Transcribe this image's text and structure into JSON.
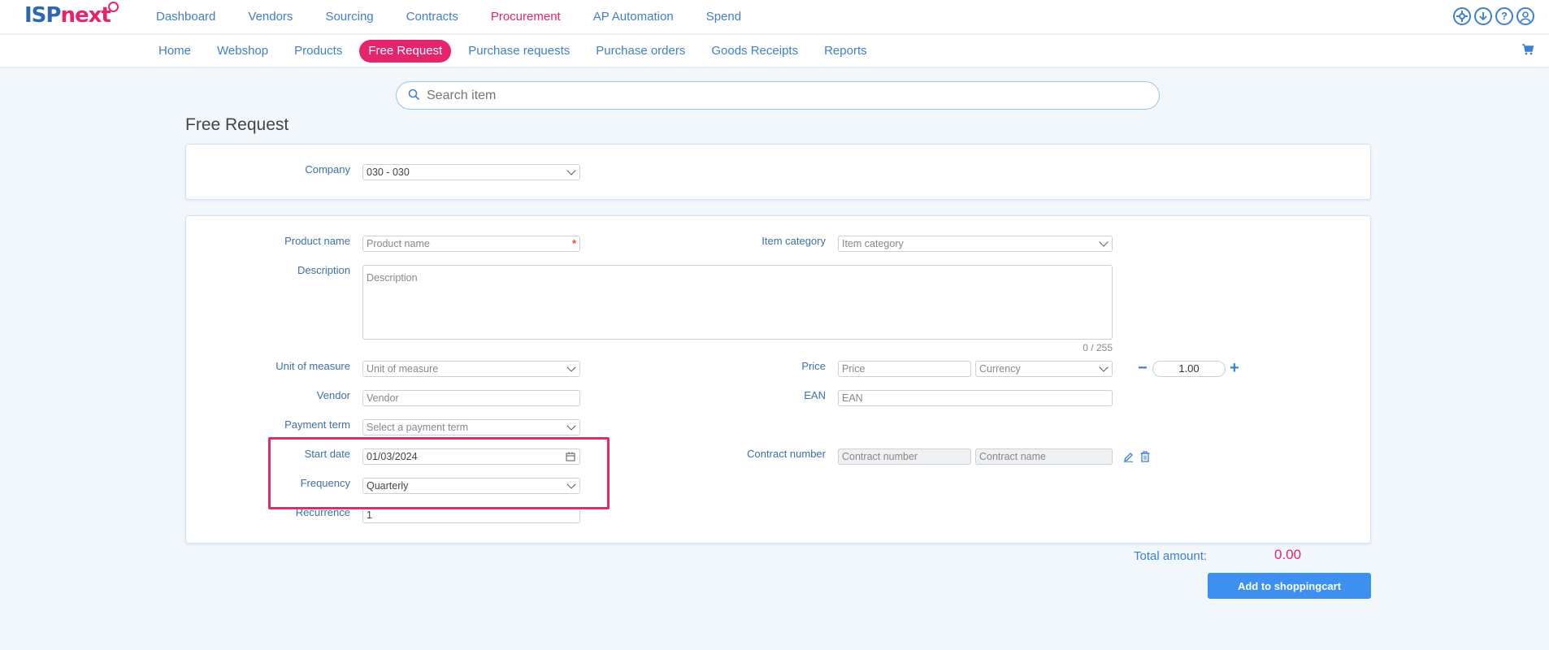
{
  "brand": {
    "logo_left": "ISP",
    "logo_right": "next"
  },
  "topnav": [
    {
      "label": "Dashboard"
    },
    {
      "label": "Vendors"
    },
    {
      "label": "Sourcing"
    },
    {
      "label": "Contracts"
    },
    {
      "label": "Procurement",
      "active": true
    },
    {
      "label": "AP Automation"
    },
    {
      "label": "Spend"
    }
  ],
  "top_icons": [
    "settings-icon",
    "download-icon",
    "help-icon",
    "user-icon"
  ],
  "subnav": [
    {
      "label": "Home"
    },
    {
      "label": "Webshop"
    },
    {
      "label": "Products"
    },
    {
      "label": "Free Request",
      "active": true
    },
    {
      "label": "Purchase requests"
    },
    {
      "label": "Purchase orders"
    },
    {
      "label": "Goods Receipts"
    },
    {
      "label": "Reports"
    }
  ],
  "search": {
    "placeholder": "Search item"
  },
  "page_title": "Free Request",
  "company": {
    "label": "Company",
    "value": "030 - 030"
  },
  "form": {
    "product_name": {
      "label": "Product name",
      "placeholder": "Product name"
    },
    "item_category": {
      "label": "Item category",
      "placeholder": "Item category"
    },
    "description": {
      "label": "Description",
      "placeholder": "Description",
      "counter": "0 / 255"
    },
    "unit_of_measure": {
      "label": "Unit of measure",
      "placeholder": "Unit of measure"
    },
    "price": {
      "label": "Price",
      "placeholder": "Price",
      "currency_placeholder": "Currency",
      "quantity": "1.00",
      "minus": "−",
      "plus": "+"
    },
    "vendor": {
      "label": "Vendor",
      "placeholder": "Vendor"
    },
    "ean": {
      "label": "EAN",
      "placeholder": "EAN"
    },
    "payment_term": {
      "label": "Payment term",
      "placeholder": "Select a payment term"
    },
    "start_date": {
      "label": "Start date",
      "value": "01/03/2024"
    },
    "contract": {
      "label": "Contract number",
      "number_placeholder": "Contract number",
      "name_placeholder": "Contract name"
    },
    "frequency": {
      "label": "Frequency",
      "value": "Quarterly"
    },
    "recurrence": {
      "label": "Recurrence",
      "value": "1"
    }
  },
  "footer": {
    "total_label": "Total amount:",
    "total_value": "0.00",
    "add_button": "Add to shoppingcart"
  },
  "colors": {
    "accent_pink": "#e6246e",
    "link_blue": "#3d7fd0",
    "button_blue": "#3d8ff0",
    "background": "#f2f7fc"
  }
}
